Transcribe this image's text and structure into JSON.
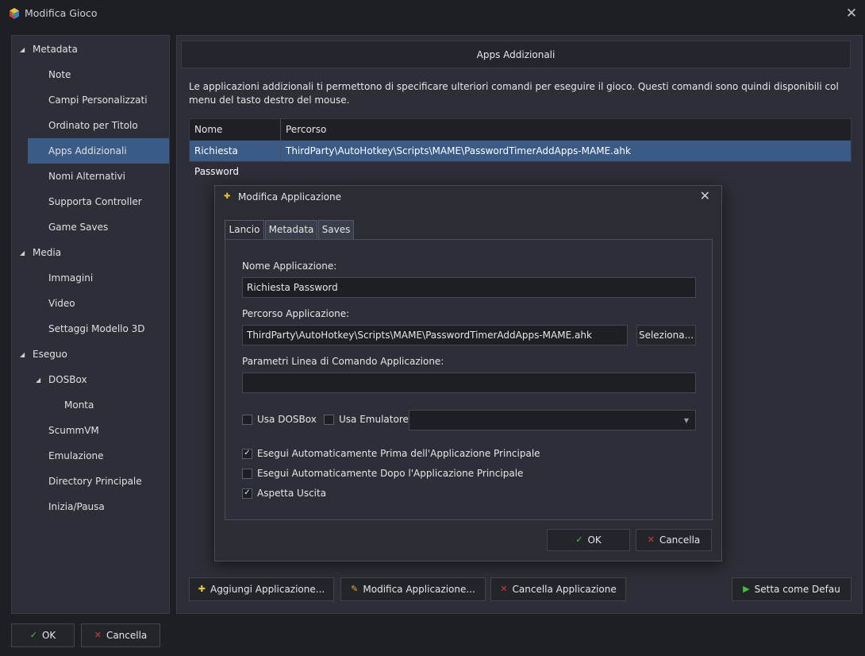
{
  "window": {
    "title": "Modifica Gioco"
  },
  "sidebar": {
    "items": [
      {
        "label": "Metadata",
        "level": 0,
        "expanded": true
      },
      {
        "label": "Note",
        "level": 1
      },
      {
        "label": "Campi Personalizzati",
        "level": 1
      },
      {
        "label": "Ordinato per Titolo",
        "level": 1
      },
      {
        "label": "Apps Addizionali",
        "level": 1,
        "selected": true
      },
      {
        "label": "Nomi Alternativi",
        "level": 1
      },
      {
        "label": "Supporta Controller",
        "level": 1
      },
      {
        "label": "Game Saves",
        "level": 1
      },
      {
        "label": "Media",
        "level": 0,
        "expanded": true
      },
      {
        "label": "Immagini",
        "level": 1
      },
      {
        "label": "Video",
        "level": 1
      },
      {
        "label": "Settaggi Modello 3D",
        "level": 1
      },
      {
        "label": "Eseguo",
        "level": 0,
        "expanded": true
      },
      {
        "label": "DOSBox",
        "level": 1,
        "expanded": true
      },
      {
        "label": "Monta",
        "level": 2
      },
      {
        "label": "ScummVM",
        "level": 1
      },
      {
        "label": "Emulazione",
        "level": 1
      },
      {
        "label": "Directory Principale",
        "level": 1
      },
      {
        "label": "Inizia/Pausa",
        "level": 1
      }
    ]
  },
  "main": {
    "header": "Apps Addizionali",
    "description": "Le applicazioni addizionali ti permettono di specificare ulteriori comandi per eseguire il gioco. Questi comandi sono quindi disponibili col menu del tasto destro del mouse.",
    "table": {
      "columns": [
        "Nome",
        "Percorso"
      ],
      "rows": [
        {
          "name": "Richiesta Password",
          "path": "ThirdParty\\AutoHotkey\\Scripts\\MAME\\PasswordTimerAddApps-MAME.ahk"
        }
      ]
    },
    "buttons": {
      "add": "Aggiungi Applicazione...",
      "edit": "Modifica Applicazione...",
      "delete": "Cancella Applicazione",
      "default": "Setta come Defau"
    }
  },
  "footer": {
    "ok": "OK",
    "cancel": "Cancella"
  },
  "dialog": {
    "title": "Modifica Applicazione",
    "tabs": [
      "Lancio",
      "Metadata",
      "Saves"
    ],
    "active_tab": "Lancio",
    "app_name_label": "Nome Applicazione:",
    "app_name_value": "Richiesta Password",
    "app_path_label": "Percorso Applicazione:",
    "app_path_value": "ThirdParty\\AutoHotkey\\Scripts\\MAME\\PasswordTimerAddApps-MAME.ahk",
    "browse_button": "Seleziona...",
    "params_label": "Parametri Linea di Comando Applicazione:",
    "params_value": "",
    "use_dosbox": {
      "label": "Usa DOSBox",
      "checked": false
    },
    "use_emulator": {
      "label": "Usa Emulatore:",
      "checked": false
    },
    "emulator_selected": "",
    "auto_before": {
      "label": "Esegui Automaticamente Prima dell'Applicazione Principale",
      "checked": true
    },
    "auto_after": {
      "label": "Esegui Automaticamente Dopo l'Applicazione Principale",
      "checked": false
    },
    "wait_exit": {
      "label": "Aspetta Uscita",
      "checked": true
    },
    "ok": "OK",
    "cancel": "Cancella"
  },
  "colors": {
    "accent": "#3a5b86",
    "background": "#1e1f24",
    "panel": "#2d2f38"
  }
}
